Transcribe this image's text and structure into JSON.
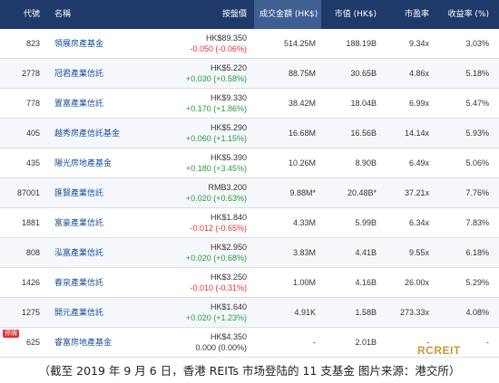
{
  "header": {
    "code": "代號",
    "name": "名稱",
    "price": "按盤價",
    "volume": "成交金額 (HK$)",
    "sort_indicator": "▼",
    "market_cap": "市值 (HK$)",
    "pe": "市盈率",
    "yield": "收益率 (%)"
  },
  "rows": [
    {
      "code": "823",
      "name": "領展房產基金",
      "price": "HK$89.350",
      "change": "-0.050 (-0.06%)",
      "trend": "down",
      "volume": "514.25M",
      "market_cap": "188.19B",
      "pe": "9.34x",
      "yield": "3.03%"
    },
    {
      "code": "2778",
      "name": "冠君產業信託",
      "price": "HK$5.220",
      "change": "+0.030 (+0.58%)",
      "trend": "up",
      "volume": "88.75M",
      "market_cap": "30.65B",
      "pe": "4.86x",
      "yield": "5.18%"
    },
    {
      "code": "778",
      "name": "置富產業信託",
      "price": "HK$9.330",
      "change": "+0.170 (+1.86%)",
      "trend": "up",
      "volume": "38.42M",
      "market_cap": "18.04B",
      "pe": "6.99x",
      "yield": "5.47%"
    },
    {
      "code": "405",
      "name": "越秀房產信託基金",
      "price": "HK$5.290",
      "change": "+0.060 (+1.15%)",
      "trend": "up",
      "volume": "16.68M",
      "market_cap": "16.56B",
      "pe": "14.14x",
      "yield": "5.93%"
    },
    {
      "code": "435",
      "name": "陽光房地產基金",
      "price": "HK$5.390",
      "change": "+0.180 (+3.45%)",
      "trend": "up",
      "volume": "10.26M",
      "market_cap": "8.90B",
      "pe": "6.49x",
      "yield": "5.06%"
    },
    {
      "code": "87001",
      "name": "匯賢產業信託",
      "price": "RMB3.200",
      "change": "+0.020 (+0.63%)",
      "trend": "up",
      "volume": "9.88M*",
      "market_cap": "20.48B*",
      "pe": "37.21x",
      "yield": "7.76%"
    },
    {
      "code": "1881",
      "name": "富豪產業信託",
      "price": "HK$1.840",
      "change": "-0.012 (-0.65%)",
      "trend": "down",
      "volume": "4.33M",
      "market_cap": "5.99B",
      "pe": "6.34x",
      "yield": "7.83%"
    },
    {
      "code": "808",
      "name": "泓富產業信託",
      "price": "HK$2.950",
      "change": "+0.020 (+0.68%)",
      "trend": "up",
      "volume": "3.83M",
      "market_cap": "4.41B",
      "pe": "9.55x",
      "yield": "6.18%"
    },
    {
      "code": "1426",
      "name": "春泉產業信託",
      "price": "HK$3.250",
      "change": "-0.010 (-0.31%)",
      "trend": "down",
      "volume": "1.00M",
      "market_cap": "4.16B",
      "pe": "26.00x",
      "yield": "5.29%"
    },
    {
      "code": "1275",
      "name": "開元產業信託",
      "price": "HK$1.640",
      "change": "+0.020 (+1.23%)",
      "trend": "up",
      "volume": "4.91K",
      "market_cap": "1.58B",
      "pe": "273.33x",
      "yield": "4.08%"
    },
    {
      "code": "625",
      "name": "睿富房地產基金",
      "price": "HK$4.350",
      "change": "0.000 (0.00%)",
      "trend": "flat",
      "volume": "-",
      "market_cap": "2.01B",
      "pe": "-",
      "yield": "-",
      "badge": "停牌"
    }
  ],
  "logo_text": "RCREIT",
  "caption": "（截至 2019 年 9 月 6 日，香港 REITs 市场登陆的 11 支基金  图片来源：港交所）",
  "colors": {
    "header_bg": "#1f3a6a",
    "sorted_bg": "#3f5f93",
    "up": "#2a9c3c",
    "down": "#e0342c",
    "name_link": "#1a4e9a"
  }
}
